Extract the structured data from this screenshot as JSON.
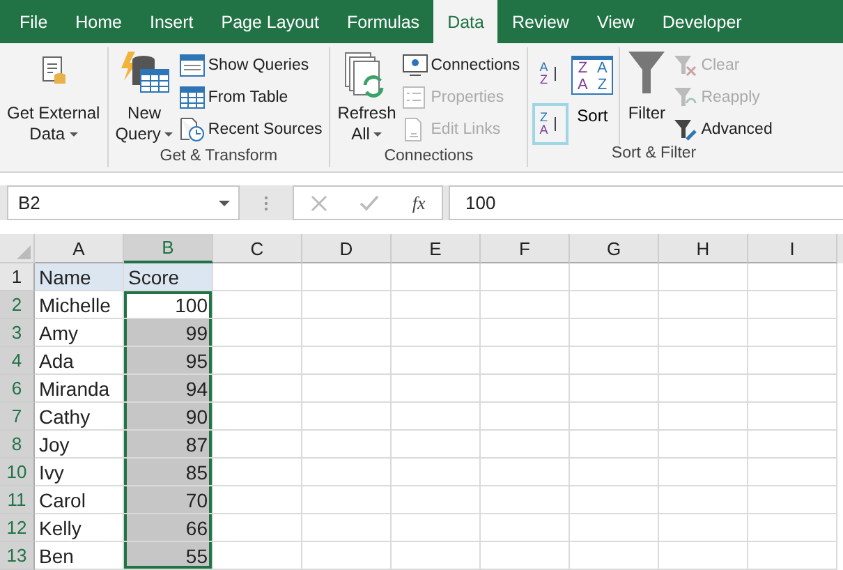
{
  "tabs": [
    {
      "label": "File",
      "selected": false
    },
    {
      "label": "Home",
      "selected": false
    },
    {
      "label": "Insert",
      "selected": false
    },
    {
      "label": "Page Layout",
      "selected": false
    },
    {
      "label": "Formulas",
      "selected": false
    },
    {
      "label": "Data",
      "selected": true
    },
    {
      "label": "Review",
      "selected": false
    },
    {
      "label": "View",
      "selected": false
    },
    {
      "label": "Developer",
      "selected": false
    }
  ],
  "ribbon": {
    "groups": [
      {
        "items": [
          {
            "kind": "large",
            "lines": [
              "Get External",
              "Data"
            ],
            "dropdown": true
          }
        ]
      },
      {
        "label": "Get & Transform",
        "items": [
          {
            "kind": "large",
            "lines": [
              "New",
              "Query"
            ],
            "dropdown": true
          },
          {
            "kind": "stack",
            "buttons": [
              {
                "label": "Show Queries",
                "disabled": false
              },
              {
                "label": "From Table",
                "disabled": false
              },
              {
                "label": "Recent Sources",
                "disabled": false
              }
            ]
          }
        ]
      },
      {
        "label": "Connections",
        "items": [
          {
            "kind": "large",
            "lines": [
              "Refresh",
              "All"
            ],
            "dropdown": true
          },
          {
            "kind": "stack",
            "buttons": [
              {
                "label": "Connections",
                "disabled": false
              },
              {
                "label": "Properties",
                "disabled": true
              },
              {
                "label": "Edit Links",
                "disabled": true
              }
            ]
          }
        ]
      },
      {
        "label": "Sort & Filter",
        "items": [
          {
            "kind": "sort-pair",
            "buttons": [
              {
                "glyphs": [
                  "A",
                  "Z"
                ],
                "highlighted": false
              },
              {
                "glyphs": [
                  "Z",
                  "A"
                ],
                "highlighted": true
              }
            ]
          },
          {
            "kind": "sort-large",
            "glyphs": [
              "Z",
              "A",
              "A",
              "Z"
            ],
            "lines": [
              "Sort"
            ]
          },
          {
            "kind": "large",
            "lines": [
              "Filter"
            ]
          },
          {
            "kind": "stack",
            "buttons": [
              {
                "label": "Clear",
                "disabled": true
              },
              {
                "label": "Reapply",
                "disabled": true
              },
              {
                "label": "Advanced",
                "disabled": false
              }
            ]
          }
        ]
      }
    ]
  },
  "formula_bar": {
    "name_box": "B2",
    "function_label": "fx",
    "value": "100"
  },
  "columns": [
    {
      "label": "A",
      "selected": false
    },
    {
      "label": "B",
      "selected": true
    },
    {
      "label": "C",
      "selected": false
    },
    {
      "label": "D",
      "selected": false
    },
    {
      "label": "E",
      "selected": false
    },
    {
      "label": "F",
      "selected": false
    },
    {
      "label": "G",
      "selected": false
    },
    {
      "label": "H",
      "selected": false
    },
    {
      "label": "I",
      "selected": false
    }
  ],
  "rows": [
    {
      "number": "1",
      "kind": "header",
      "cells": [
        "Name",
        "Score"
      ],
      "selected": false,
      "active": false
    },
    {
      "number": "2",
      "kind": "data",
      "cells": [
        "Michelle",
        "100"
      ],
      "selected": true,
      "active": true
    },
    {
      "number": "3",
      "kind": "data",
      "cells": [
        "Amy",
        "99"
      ],
      "selected": true,
      "active": false
    },
    {
      "number": "4",
      "kind": "data",
      "cells": [
        "Ada",
        "95"
      ],
      "selected": true,
      "active": false
    },
    {
      "number": "6",
      "kind": "data",
      "cells": [
        "Miranda",
        "94"
      ],
      "selected": true,
      "active": false
    },
    {
      "number": "7",
      "kind": "data",
      "cells": [
        "Cathy",
        "90"
      ],
      "selected": true,
      "active": false
    },
    {
      "number": "8",
      "kind": "data",
      "cells": [
        "Joy",
        "87"
      ],
      "selected": true,
      "active": false
    },
    {
      "number": "10",
      "kind": "data",
      "cells": [
        "Ivy",
        "85"
      ],
      "selected": true,
      "active": false
    },
    {
      "number": "11",
      "kind": "data",
      "cells": [
        "Carol",
        "70"
      ],
      "selected": true,
      "active": false
    },
    {
      "number": "12",
      "kind": "data",
      "cells": [
        "Kelly",
        "66"
      ],
      "selected": true,
      "active": false
    },
    {
      "number": "13",
      "kind": "data",
      "cells": [
        "Ben",
        "55"
      ],
      "selected": true,
      "active": false
    }
  ]
}
